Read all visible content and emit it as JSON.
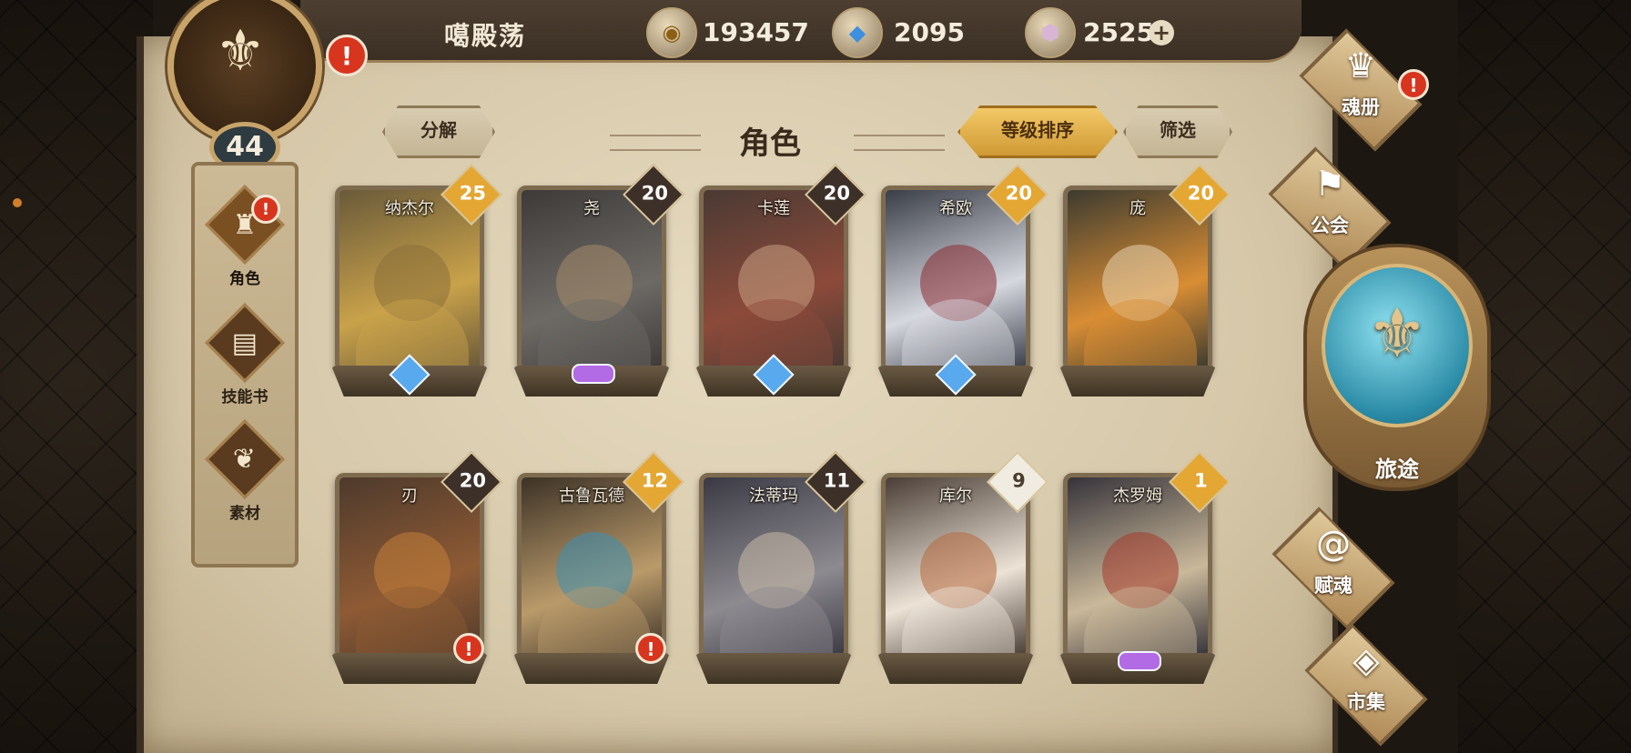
{
  "header": {
    "player_name": "噶殿荡",
    "currencies": [
      {
        "icon": "coin-icon",
        "value": "193457"
      },
      {
        "icon": "crystal-icon",
        "value": "2095"
      },
      {
        "icon": "gem-icon",
        "value": "2525"
      }
    ],
    "plus": "+"
  },
  "emblem": {
    "level": "44",
    "alert": "!"
  },
  "nav": [
    {
      "label": "角色",
      "icon": "helmet-icon",
      "alert": "!"
    },
    {
      "label": "技能书",
      "icon": "skill-book-icon"
    },
    {
      "label": "素材",
      "icon": "material-icon"
    }
  ],
  "toolbar": {
    "decompose": "分解",
    "title": "角色",
    "sort": "等级排序",
    "filter": "筛选"
  },
  "characters": [
    {
      "name": "纳杰尔",
      "level": "25",
      "badge": "gold",
      "gem": "blue"
    },
    {
      "name": "尧",
      "level": "20",
      "badge": "dark",
      "gem": "purple"
    },
    {
      "name": "卡莲",
      "level": "20",
      "badge": "dark",
      "gem": "blue"
    },
    {
      "name": "希欧",
      "level": "20",
      "badge": "gold",
      "gem": "blue"
    },
    {
      "name": "庞",
      "level": "20",
      "badge": "gold",
      "gem": "none"
    },
    {
      "name": "刃",
      "level": "20",
      "badge": "dark",
      "gem": "none",
      "alert": "!"
    },
    {
      "name": "古鲁瓦德",
      "level": "12",
      "badge": "gold",
      "gem": "none",
      "alert": "!"
    },
    {
      "name": "法蒂玛",
      "level": "11",
      "badge": "dark",
      "gem": "none"
    },
    {
      "name": "库尔",
      "level": "9",
      "badge": "light",
      "gem": "none"
    },
    {
      "name": "杰罗姆",
      "level": "1",
      "badge": "gold",
      "gem": "purple"
    }
  ],
  "right_menu": {
    "book": {
      "label": "魂册",
      "alert": "!"
    },
    "guild": {
      "label": "公会"
    },
    "journey": {
      "label": "旅途"
    },
    "soul": {
      "label": "赋魂"
    },
    "market": {
      "label": "市集"
    }
  },
  "colors": {
    "accent_gold": "#e4a733",
    "alert_red": "#d8351f",
    "gem_blue": "#59a9ef",
    "gem_purple": "#b26be4"
  }
}
